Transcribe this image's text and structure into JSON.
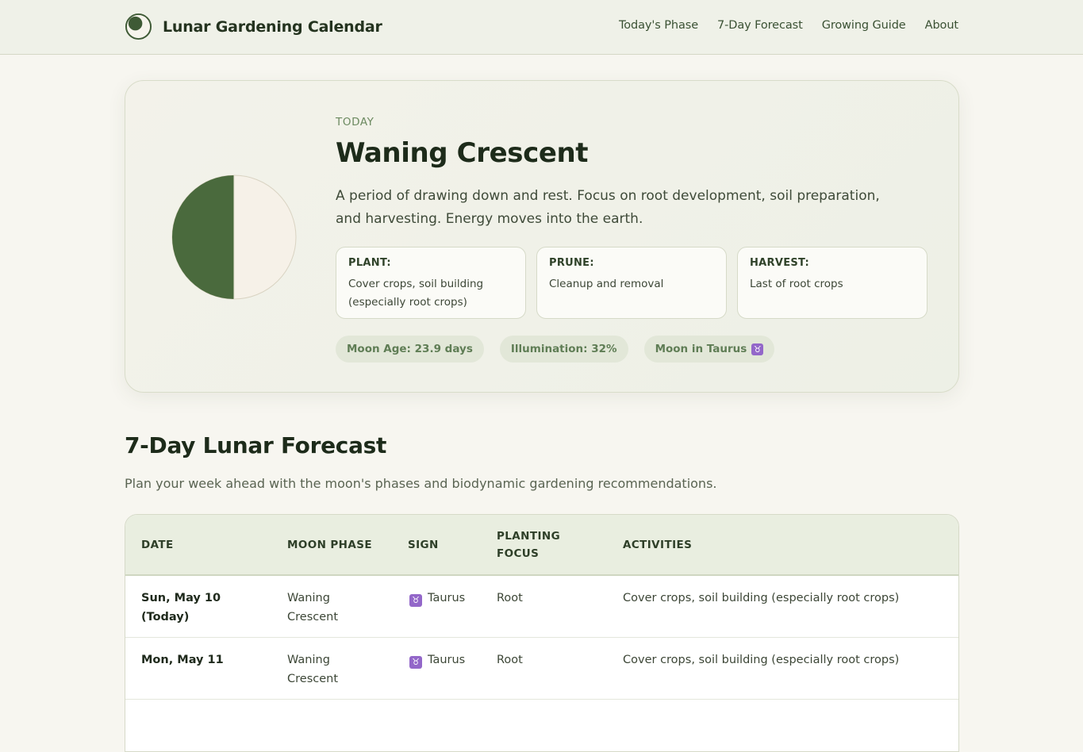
{
  "header": {
    "title": "Lunar Gardening Calendar",
    "nav": [
      "Today's Phase",
      "7-Day Forecast",
      "Growing Guide",
      "About"
    ]
  },
  "hero": {
    "label": "TODAY",
    "phase": "Waning Crescent",
    "description": "A period of drawing down and rest. Focus on root development, soil preparation, and harvesting. Energy moves into the earth.",
    "recommendations": [
      {
        "label": "PLANT:",
        "value": "Cover crops, soil building (especially root crops)"
      },
      {
        "label": "PRUNE:",
        "value": "Cleanup and removal"
      },
      {
        "label": "HARVEST:",
        "value": "Last of root crops"
      }
    ],
    "stats": {
      "age": "Moon Age: 23.9 days",
      "illumination": "Illumination: 32%",
      "sign": "Moon in Taurus",
      "sign_glyph": "♉"
    }
  },
  "forecast": {
    "title": "7-Day Lunar Forecast",
    "subtitle": "Plan your week ahead with the moon's phases and biodynamic gardening recommendations.",
    "columns": [
      "DATE",
      "MOON PHASE",
      "SIGN",
      "PLANTING FOCUS",
      "ACTIVITIES"
    ],
    "rows": [
      {
        "date": "Sun, May 10 (Today)",
        "phase": "Waning Crescent",
        "sign_glyph": "♉",
        "sign": "Taurus",
        "focus": "Root",
        "activities": "Cover crops, soil building (especially root crops)"
      },
      {
        "date": "Mon, May 11",
        "phase": "Waning Crescent",
        "sign_glyph": "♉",
        "sign": "Taurus",
        "focus": "Root",
        "activities": "Cover crops, soil building (especially root crops)"
      }
    ]
  },
  "colors": {
    "accent": "#4a6a3d",
    "moon_light": "#f6f1e8",
    "sign_badge": "#9367c9"
  }
}
